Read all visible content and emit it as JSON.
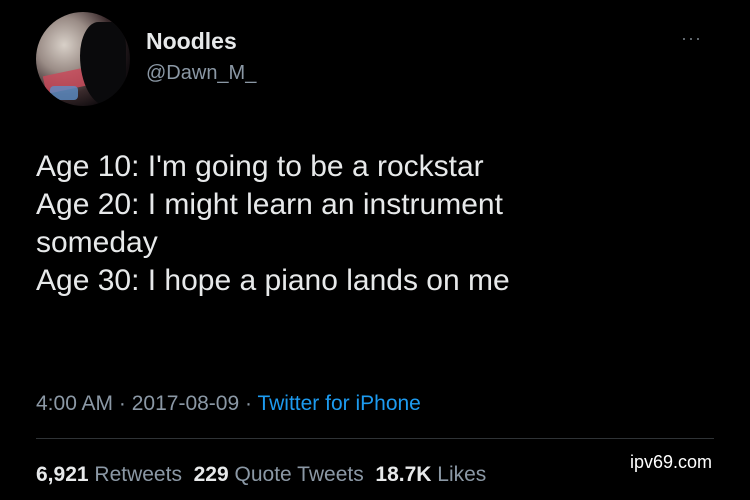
{
  "user": {
    "name": "Noodles",
    "handle": "@Dawn_M_",
    "more_icon": "more-horizontal-icon",
    "more_glyph": "···"
  },
  "tweet": {
    "lines": [
      "Age 10: I'm going to be a rockstar",
      "Age 20: I might learn an instrument",
      "someday",
      "Age 30: I hope a piano lands on me"
    ],
    "time": "4:00 AM",
    "separator": " · ",
    "date": "2017-08-09",
    "source": "Twitter for iPhone"
  },
  "stats": {
    "retweets_count": "6,921",
    "retweets_label": "Retweets",
    "quotes_count": "229",
    "quotes_label": "Quote Tweets",
    "likes_count": "18.7K",
    "likes_label": "Likes"
  },
  "watermark": "ipv69.com",
  "colors": {
    "background": "#000000",
    "text": "#e7e9ea",
    "muted": "#8b98a5",
    "link": "#1d9bf0"
  }
}
